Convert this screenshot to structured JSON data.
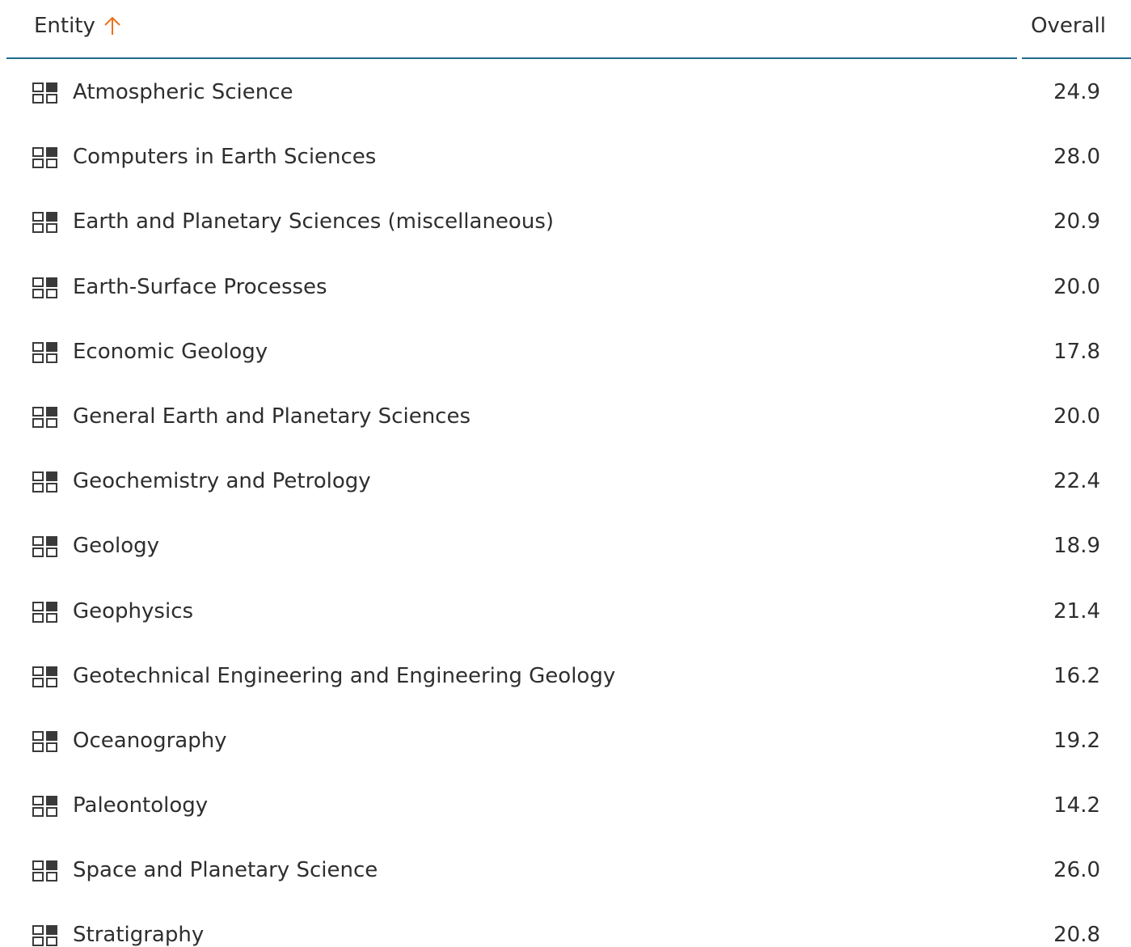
{
  "header": {
    "entity_label": "Entity",
    "overall_label": "Overall",
    "sort_icon": "arrow-up-icon",
    "sort_color": "#e9711c",
    "rule_color": "#1f6a8f"
  },
  "row_icon": "grid-icon",
  "rows": [
    {
      "name": "Atmospheric Science",
      "value": "24.9"
    },
    {
      "name": "Computers in Earth Sciences",
      "value": "28.0"
    },
    {
      "name": "Earth and Planetary Sciences (miscellaneous)",
      "value": "20.9"
    },
    {
      "name": "Earth-Surface Processes",
      "value": "20.0"
    },
    {
      "name": "Economic Geology",
      "value": "17.8"
    },
    {
      "name": "General Earth and Planetary Sciences",
      "value": "20.0"
    },
    {
      "name": "Geochemistry and Petrology",
      "value": "22.4"
    },
    {
      "name": "Geology",
      "value": "18.9"
    },
    {
      "name": "Geophysics",
      "value": "21.4"
    },
    {
      "name": "Geotechnical Engineering and Engineering Geology",
      "value": "16.2"
    },
    {
      "name": "Oceanography",
      "value": "19.2"
    },
    {
      "name": "Paleontology",
      "value": "14.2"
    },
    {
      "name": "Space and Planetary Science",
      "value": "26.0"
    },
    {
      "name": "Stratigraphy",
      "value": "20.8"
    }
  ]
}
